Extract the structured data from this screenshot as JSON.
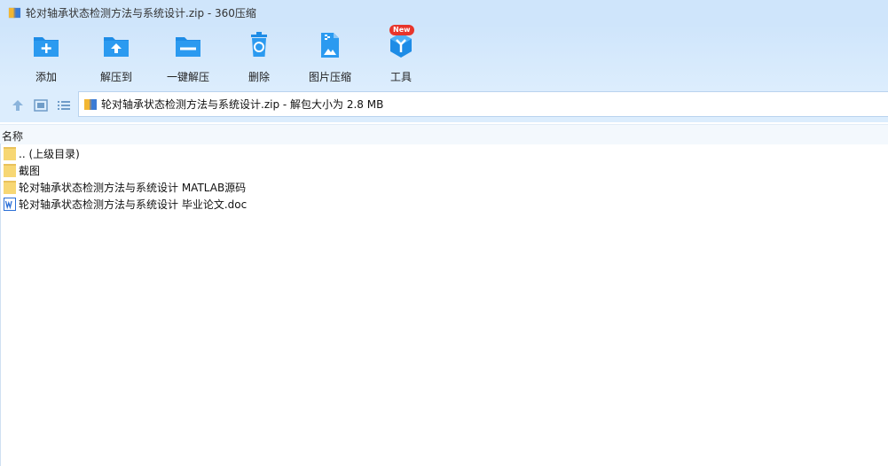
{
  "window": {
    "title": "轮对轴承状态检测方法与系统设计.zip - 360压缩"
  },
  "toolbar": {
    "add": "添加",
    "extract_to": "解压到",
    "one_click_extract": "一键解压",
    "delete": "删除",
    "image_compress": "图片压缩",
    "tools": "工具",
    "new_badge": "New"
  },
  "address": {
    "path": "轮对轴承状态检测方法与系统设计.zip - 解包大小为 2.8 MB"
  },
  "columns": {
    "name": "名称"
  },
  "files": [
    {
      "name": ".. (上级目录)",
      "icon": "folder-icon"
    },
    {
      "name": "截图",
      "icon": "folder-icon"
    },
    {
      "name": "轮对轴承状态检测方法与系统设计 MATLAB源码",
      "icon": "folder-icon"
    },
    {
      "name": "轮对轴承状态检测方法与系统设计 毕业论文.doc",
      "icon": "word-doc-icon"
    }
  ],
  "colors": {
    "accent": "#1e8ce6",
    "toolbar_bg": "#cfe5fb",
    "folder": "#f7d774",
    "badge": "#e8352b"
  }
}
